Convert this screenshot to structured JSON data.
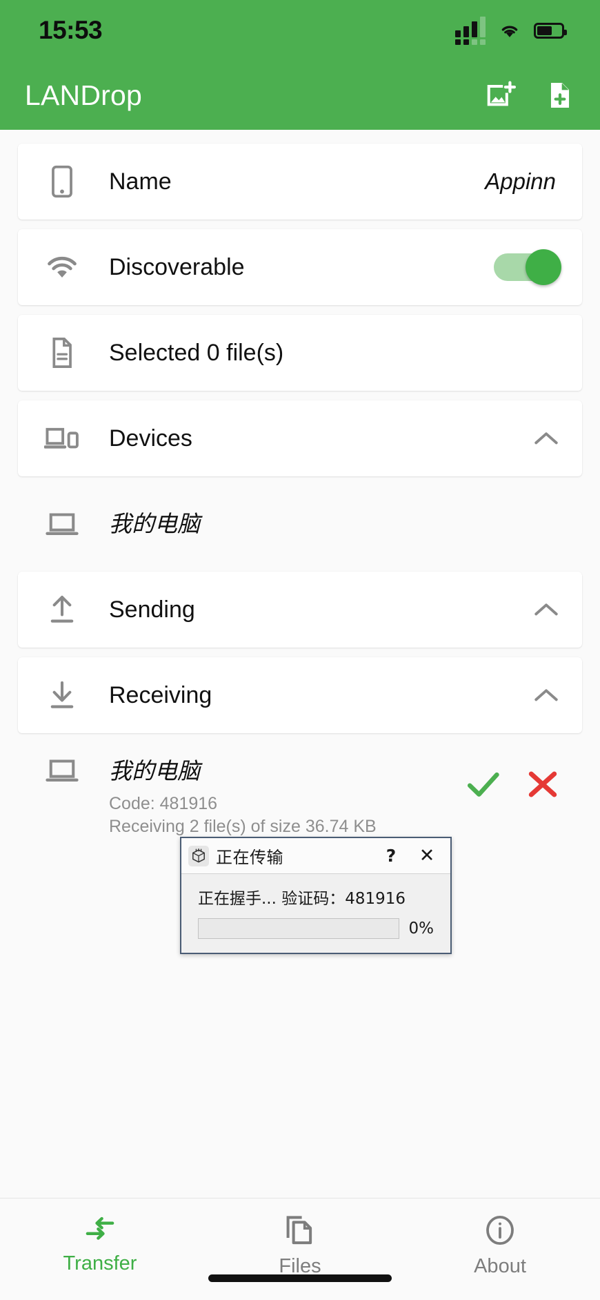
{
  "status_bar": {
    "time": "15:53",
    "signal_icon": "cellular-signal-icon",
    "wifi_icon": "wifi-icon",
    "battery_icon": "battery-icon",
    "battery_level_percent": 62
  },
  "app_bar": {
    "title": "LANDrop",
    "actions": [
      {
        "name": "add-image-button",
        "icon": "add-image-icon"
      },
      {
        "name": "add-file-button",
        "icon": "add-file-icon"
      }
    ]
  },
  "rows": {
    "name": {
      "icon": "smartphone-icon",
      "label": "Name",
      "value": "Appinn"
    },
    "discoverable": {
      "icon": "wifi-icon",
      "label": "Discoverable",
      "toggle_on": true
    },
    "selected": {
      "icon": "file-icon",
      "label": "Selected 0 file(s)"
    },
    "devices": {
      "icon": "devices-icon",
      "label": "Devices",
      "chevron": "chevron-up-icon"
    },
    "device_item": {
      "icon": "laptop-icon",
      "label": "我的电脑"
    },
    "sending": {
      "icon": "upload-icon",
      "label": "Sending",
      "chevron": "chevron-up-icon"
    },
    "receiving": {
      "icon": "download-icon",
      "label": "Receiving",
      "chevron": "chevron-up-icon"
    }
  },
  "receiving_item": {
    "icon": "laptop-icon",
    "title": "我的电脑",
    "code_line": "Code: 481916",
    "detail_line": "Receiving 2 file(s) of size 36.74 KB",
    "accept_icon": "check-icon",
    "reject_icon": "close-icon",
    "accept_color": "#4CAF50",
    "reject_color": "#E53935"
  },
  "dialog": {
    "icon": "package-icon",
    "title": "正在传输",
    "help_label": "?",
    "close_label": "✕",
    "status_text": "正在握手...  验证码：481916",
    "progress_percent": 0,
    "progress_label": "0%"
  },
  "bottom_nav": {
    "items": [
      {
        "name": "nav-transfer",
        "icon": "transfer-arrows-icon",
        "label": "Transfer",
        "active": true
      },
      {
        "name": "nav-files",
        "icon": "copy-files-icon",
        "label": "Files",
        "active": false
      },
      {
        "name": "nav-about",
        "icon": "info-circle-icon",
        "label": "About",
        "active": false
      }
    ]
  },
  "theme": {
    "accent": "#4CAF50",
    "muted_icon": "#8a8a8a",
    "text": "#111111"
  }
}
